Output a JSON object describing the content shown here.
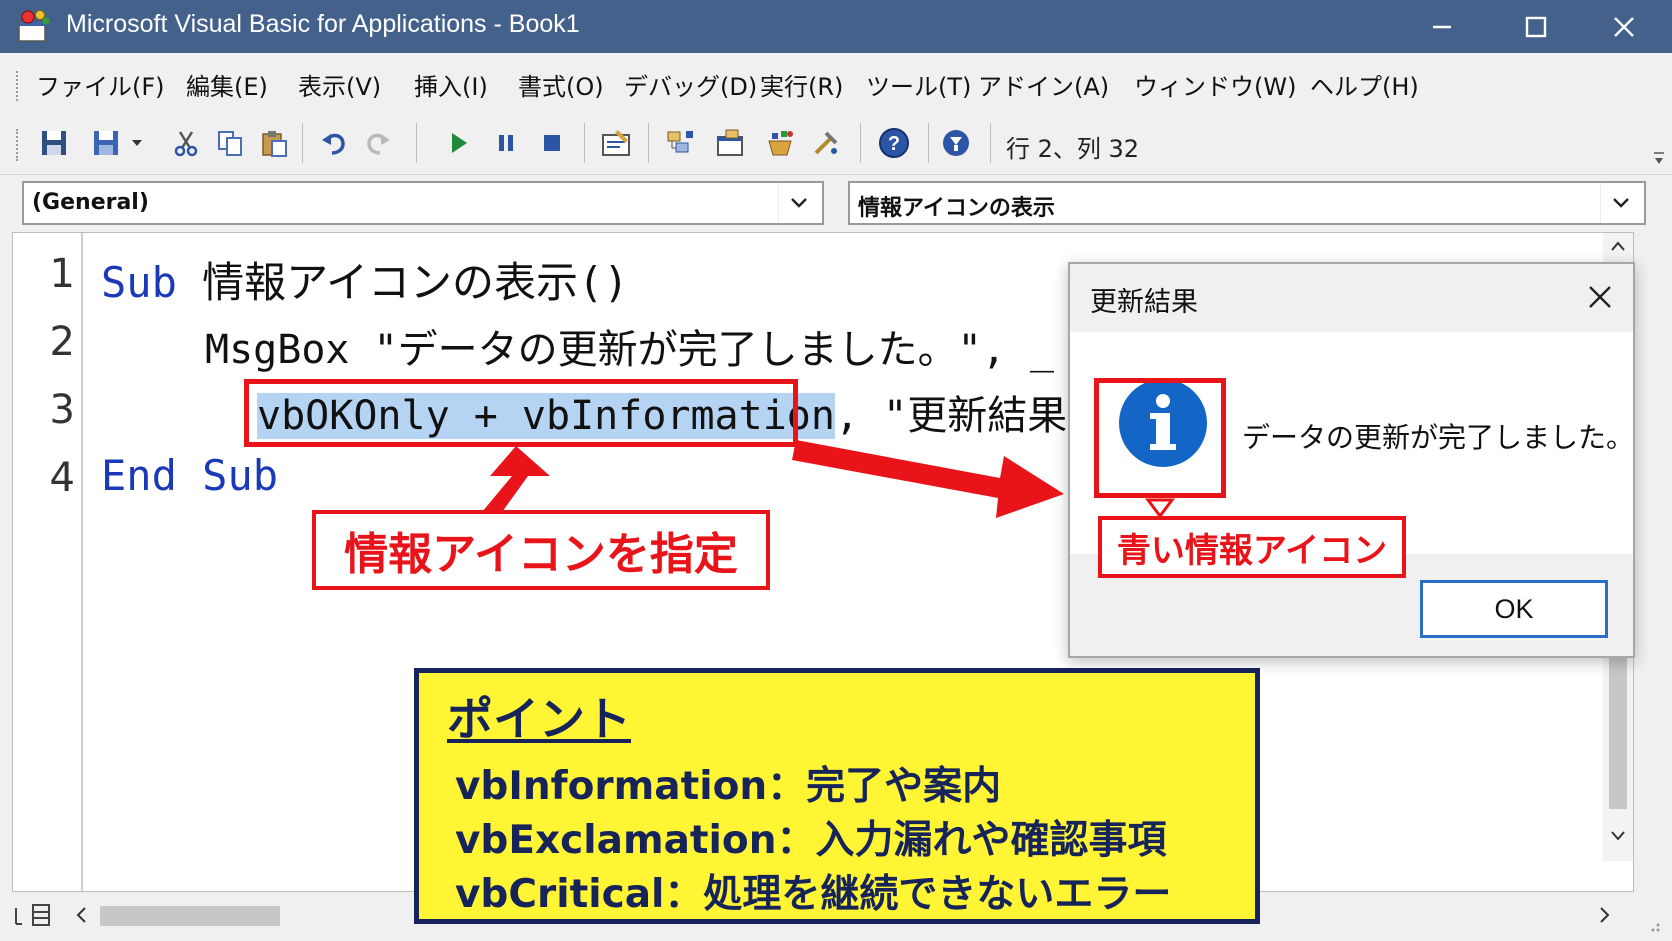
{
  "window": {
    "title": "Microsoft Visual Basic for Applications - Book1",
    "controls": [
      "minimize-icon",
      "maximize-icon",
      "close-icon"
    ]
  },
  "menu": [
    "ファイル(F)",
    "編集(E)",
    "表示(V)",
    "挿入(I)",
    "書式(O)",
    "デバッグ(D)",
    "実行(R)",
    "ツール(T)",
    "アドイン(A)",
    "ウィンドウ(W)",
    "ヘルプ(H)"
  ],
  "toolbar": {
    "icons": [
      "save-icon",
      "save-dropdown-icon",
      "cut-icon",
      "copy-icon",
      "paste-icon",
      "undo-icon",
      "redo-icon",
      "run-icon",
      "pause-icon",
      "stop-icon",
      "design-mode-icon",
      "project-explorer-icon",
      "properties-icon",
      "object-browser-icon",
      "toolbox-icon",
      "help-icon",
      "assistant-icon"
    ],
    "cursor_position": "行 2、列 32"
  },
  "combos": {
    "object": "(General)",
    "procedure": "情報アイコンの表示"
  },
  "editor": {
    "line_numbers": [
      "1",
      "2",
      "3",
      "4"
    ],
    "line1": {
      "keyword": "Sub",
      "rest": "情報アイコンの表示()"
    },
    "line2": {
      "text": "MsgBox \"データの更新が完了しました。\", _"
    },
    "line3": {
      "selected": "vbOKOnly + vbInformation",
      "rest": ", \"更新結果\""
    },
    "line4": {
      "kw1": "End",
      "kw2": "Sub"
    }
  },
  "dialog": {
    "title": "更新結果",
    "message": "データの更新が完了しました。",
    "icon_glyph": "i",
    "ok_label": "OK"
  },
  "annotations": {
    "specify_callout": "情報アイコンを指定",
    "icon_callout": "青い情報アイコン",
    "accent_red": "#e8141a"
  },
  "point": {
    "title": "ポイント",
    "lines": [
      "vbInformation：完了や案内",
      "vbExclamation：入力漏れや確認事項",
      "vbCritical：処理を継続できないエラー"
    ]
  },
  "colors": {
    "titlebar": "#44618b",
    "keyword": "#1a39b8",
    "selection": "#b5d3f3",
    "info_icon": "#1466c6",
    "point_bg": "#fff535",
    "point_text": "#17245a"
  }
}
